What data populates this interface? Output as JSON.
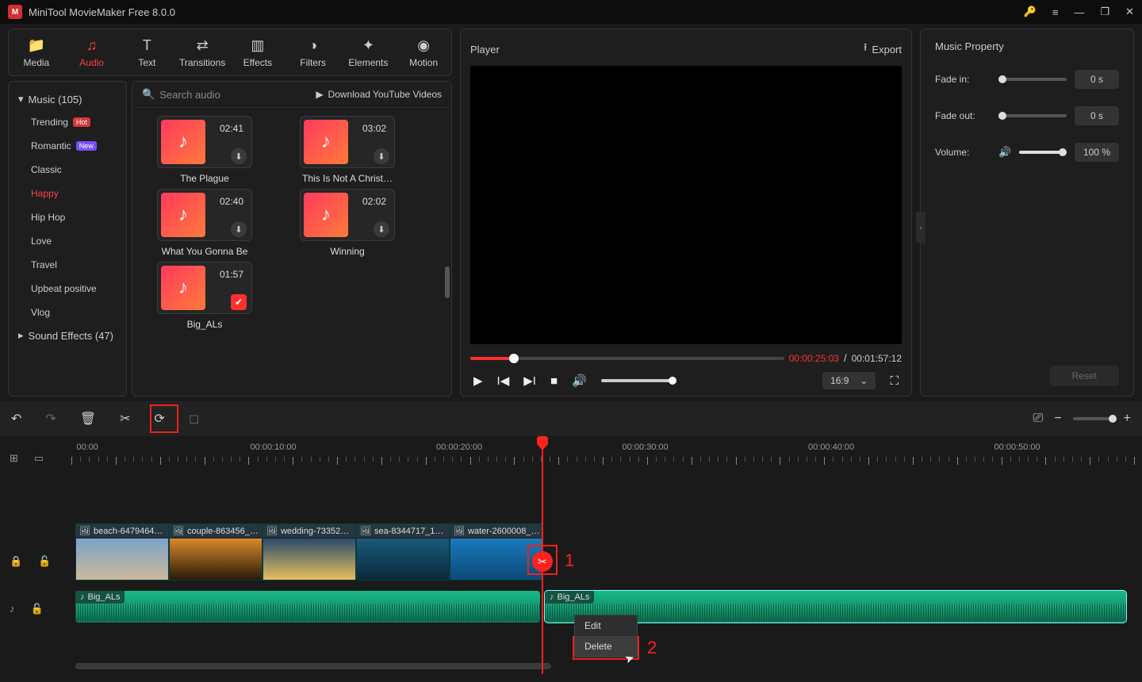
{
  "titlebar": {
    "app_title": "MiniTool MovieMaker Free 8.0.0"
  },
  "tabs": {
    "media": "Media",
    "audio": "Audio",
    "text": "Text",
    "transitions": "Transitions",
    "effects": "Effects",
    "filters": "Filters",
    "elements": "Elements",
    "motion": "Motion"
  },
  "sidebar": {
    "music_head": "Music (105)",
    "items": [
      "Trending",
      "Romantic",
      "Classic",
      "Happy",
      "Hip Hop",
      "Love",
      "Travel",
      "Upbeat positive",
      "Vlog"
    ],
    "sound_head": "Sound Effects (47)"
  },
  "grid": {
    "search_placeholder": "Search audio",
    "download_label": "Download YouTube Videos",
    "cards": [
      {
        "dur": "02:41",
        "title": "The Plague",
        "added": false
      },
      {
        "dur": "03:02",
        "title": "This Is Not A Christ…",
        "added": false
      },
      {
        "dur": "02:40",
        "title": "What You Gonna Be",
        "added": false
      },
      {
        "dur": "02:02",
        "title": "Winning",
        "added": false
      },
      {
        "dur": "01:57",
        "title": "Big_ALs",
        "added": true
      }
    ]
  },
  "player": {
    "title": "Player",
    "export": "Export",
    "cur": "00:00:25:03",
    "sep": " / ",
    "tot": "00:01:57:12",
    "aspect": "16:9"
  },
  "props": {
    "title": "Music Property",
    "fade_in_lbl": "Fade in:",
    "fade_in_val": "0 s",
    "fade_out_lbl": "Fade out:",
    "fade_out_val": "0 s",
    "volume_lbl": "Volume:",
    "volume_val": "100 %",
    "reset": "Reset"
  },
  "ruler": {
    "labels": [
      "00:00",
      "00:00:10:00",
      "00:00:20:00",
      "00:00:30:00",
      "00:00:40:00",
      "00:00:50:00"
    ]
  },
  "clips": {
    "v": [
      "beach-6479464…",
      "couple-863456_…",
      "wedding-73352…",
      "sea-8344717_1…",
      "water-2600008_…"
    ],
    "a1": "Big_ALs",
    "a2": "Big_ALs"
  },
  "context_menu": {
    "edit": "Edit",
    "delete": "Delete"
  },
  "anno": {
    "one": "1",
    "two": "2"
  }
}
